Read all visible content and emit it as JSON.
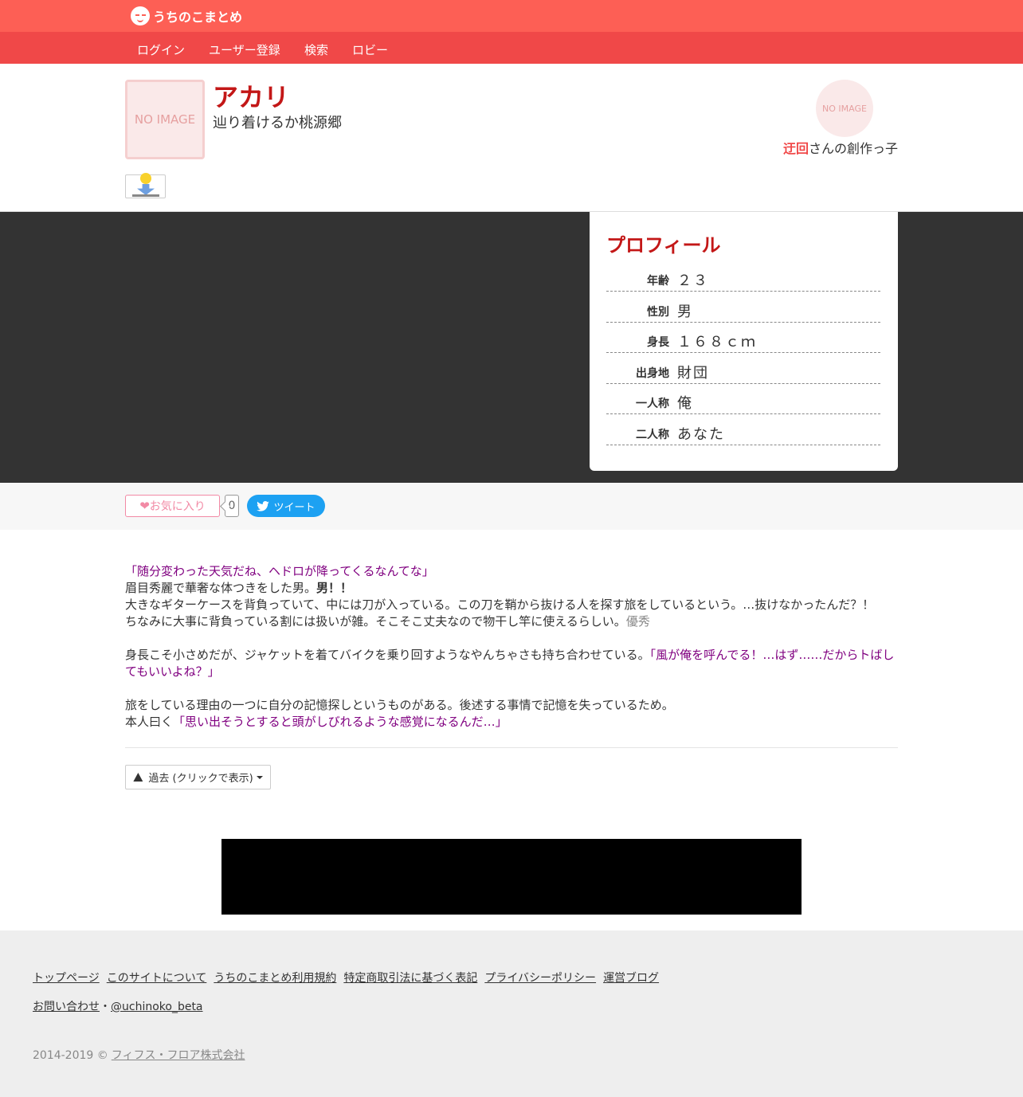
{
  "site": {
    "logo_text": "うちのこまとめ"
  },
  "nav": {
    "items": [
      "ログイン",
      "ユーザー登録",
      "検索",
      "ロビー"
    ]
  },
  "character": {
    "avatar_placeholder": "NO IMAGE",
    "name": "アカリ",
    "subtitle": "辿り着けるか桃源郷"
  },
  "author": {
    "avatar_placeholder": "NO IMAGE",
    "name": "迂回",
    "suffix": "さんの創作っ子"
  },
  "profile": {
    "title": "プロフィール",
    "rows": [
      {
        "key": "年齢",
        "value": "２３"
      },
      {
        "key": "性別",
        "value": "男"
      },
      {
        "key": "身長",
        "value": "１６８ｃｍ"
      },
      {
        "key": "出身地",
        "value": "財団"
      },
      {
        "key": "一人称",
        "value": "俺"
      },
      {
        "key": "二人称",
        "value": "あなた"
      }
    ]
  },
  "actions": {
    "favorite_label": "お気に入り",
    "favorite_count": "0",
    "tweet_label": "ツイート"
  },
  "content": {
    "quote1": "「随分変わった天気だね、ヘドロが降ってくるなんてな」",
    "line2_text": "眉目秀麗で華奢な体つきをした男。",
    "line2_bold": "男！！",
    "line3": "大きなギターケースを背負っていて、中には刀が入っている。この刀を鞘から抜ける人を探す旅をしているという。…抜けなかったんだ？！",
    "line4_text": "ちなみに大事に背負っている割には扱いが雑。そこそこ丈夫なので物干し竿に使えるらしい。",
    "line4_gray": "優秀",
    "line5_text": "身長こそ小さめだが、ジャケットを着てバイクを乗り回すようなやんちゃさも持ち合わせている。",
    "line5_quote": "「風が俺を呼んでる！…はず……だからトばしてもいいよね？」",
    "line6": "旅をしている理由の一つに自分の記憶探しというものがある。後述する事情で記憶を失っているため。",
    "line7_text": "本人曰く",
    "line7_quote": "「思い出そうとすると頭がしびれるような感覚になるんだ…」"
  },
  "past_button": {
    "label": "過去 (クリックで表示)"
  },
  "footer": {
    "links": [
      "トップページ",
      "このサイトについて",
      "うちのこまとめ利用規約",
      "特定商取引法に基づく表記",
      "プライバシーポリシー",
      "運営ブログ"
    ],
    "contact_label": "お問い合わせ",
    "separator": "・",
    "twitter": "@uchinoko_beta",
    "copyright": "2014-2019 ©",
    "company": "フィフス・フロア株式会社"
  }
}
